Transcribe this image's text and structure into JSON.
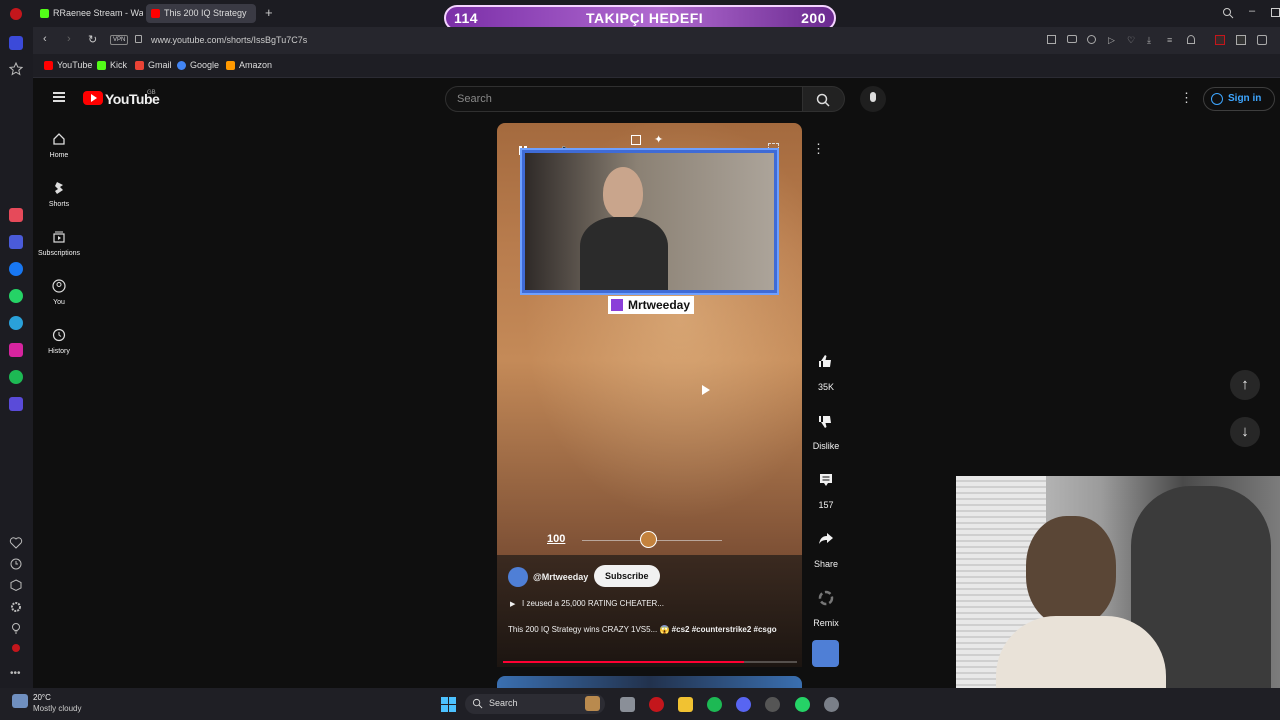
{
  "browser": {
    "tabs": [
      {
        "label": "RRaenee Stream - Watch",
        "favicon_color": "#53fc18"
      },
      {
        "label": "This 200 IQ Strategy",
        "favicon_color": "#ff0000"
      }
    ],
    "url": "www.youtube.com/shorts/IssBgTu7C7s",
    "vpn_label": "VPN",
    "bookmarks": [
      {
        "label": "YouTube",
        "color": "#ff0000"
      },
      {
        "label": "Kick",
        "color": "#53fc18"
      },
      {
        "label": "Gmail",
        "color": "#ea4335"
      },
      {
        "label": "Google",
        "color": "#4285f4"
      },
      {
        "label": "Amazon",
        "color": "#ff9900"
      }
    ]
  },
  "goal": {
    "current": "114",
    "title": "TAKIPÇI HEDEFI",
    "target": "200"
  },
  "youtube": {
    "logo_text": "YouTube",
    "region": "GB",
    "search_placeholder": "Search",
    "sign_in": "Sign in",
    "nav": [
      {
        "label": "Home",
        "icon": "home-icon"
      },
      {
        "label": "Shorts",
        "icon": "shorts-icon"
      },
      {
        "label": "Subscriptions",
        "icon": "subscriptions-icon"
      },
      {
        "label": "You",
        "icon": "you-icon"
      },
      {
        "label": "History",
        "icon": "history-icon"
      }
    ]
  },
  "short": {
    "streamer_tag": "Mrtweeday",
    "hud_value": "100",
    "channel": "@Mrtweeday",
    "subscribe": "Subscribe",
    "related": "I zeused a 25,000 RATING CHEATER...",
    "title": "This 200 IQ Strategy wins CRAZY 1VS5... 😱",
    "hashtags": [
      "#cs2",
      "#counterstrike2",
      "#csgo"
    ],
    "progress": 0.82
  },
  "actions": [
    {
      "label": "35K",
      "icon": "like-icon"
    },
    {
      "label": "Dislike",
      "icon": "dislike-icon"
    },
    {
      "label": "157",
      "icon": "comment-icon"
    },
    {
      "label": "Share",
      "icon": "share-icon"
    },
    {
      "label": "Remix",
      "icon": "remix-icon"
    }
  ],
  "taskbar": {
    "weather_temp": "20°C",
    "weather_text": "Mostly cloudy",
    "search_label": "Search"
  }
}
